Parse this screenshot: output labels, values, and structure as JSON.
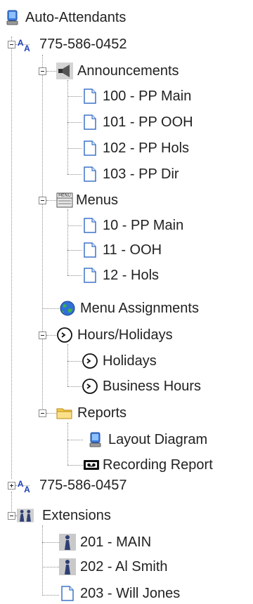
{
  "root": {
    "label": "Auto-Attendants",
    "icon": "computer-globe-icon"
  },
  "attendant_1": {
    "label": "775-586-0452",
    "icon": "attendant-aa-icon",
    "announcements": {
      "label": "Announcements",
      "icon": "announcement-speaker-icon",
      "items": [
        {
          "label": "100 - PP Main",
          "icon": "document-icon"
        },
        {
          "label": "101 - PP OOH",
          "icon": "document-icon"
        },
        {
          "label": "102 - PP Hols",
          "icon": "document-icon"
        },
        {
          "label": "103 - PP Dir",
          "icon": "document-icon"
        }
      ]
    },
    "menus": {
      "label": "Menus",
      "icon": "menu-icon",
      "icon_text": "MENU",
      "items": [
        {
          "label": "10 - PP Main",
          "icon": "document-icon"
        },
        {
          "label": "11 - OOH",
          "icon": "document-icon"
        },
        {
          "label": "12 - Hols",
          "icon": "document-icon"
        }
      ]
    },
    "menu_assignments": {
      "label": "Menu Assignments",
      "icon": "globe-icon"
    },
    "hours_holidays": {
      "label": "Hours/Holidays",
      "icon": "clock-icon",
      "items": [
        {
          "label": "Holidays",
          "icon": "clock-icon"
        },
        {
          "label": "Business Hours",
          "icon": "clock-icon"
        }
      ]
    },
    "reports": {
      "label": "Reports",
      "icon": "folder-icon",
      "items": [
        {
          "label": "Layout Diagram",
          "icon": "computer-globe-icon"
        },
        {
          "label": "Recording Report",
          "icon": "tape-recorder-icon"
        }
      ]
    }
  },
  "attendant_2": {
    "label": "775-586-0457",
    "icon": "attendant-aa-icon"
  },
  "extensions": {
    "label": "Extensions",
    "icon": "people-icon",
    "items": [
      {
        "label": "201 - MAIN",
        "icon": "person-icon"
      },
      {
        "label": "202 - Al Smith",
        "icon": "person-icon"
      },
      {
        "label": "203 - Will Jones",
        "icon": "document-icon"
      }
    ]
  },
  "colors": {
    "accent_blue": "#1b3fb8",
    "folder_yellow": "#f6cc4a",
    "line_gray": "#8c8c8c"
  }
}
